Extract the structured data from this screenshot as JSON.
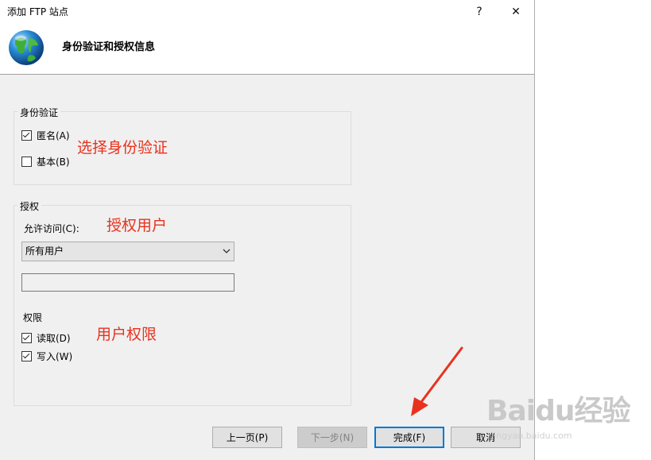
{
  "window": {
    "title": "添加 FTP 站点",
    "help_label": "?",
    "close_label": "✕"
  },
  "header": {
    "title": "身份验证和授权信息",
    "icon": "globe-icon"
  },
  "authentication": {
    "legend": "身份验证",
    "options": [
      {
        "label": "匿名(A)",
        "checked": true
      },
      {
        "label": "基本(B)",
        "checked": false
      }
    ]
  },
  "authorization": {
    "legend": "授权",
    "allow_access_label": "允许访问(C):",
    "allow_access_value": "所有用户",
    "user_textbox_value": "",
    "permissions_label": "权限",
    "permissions": [
      {
        "label": "读取(D)",
        "checked": true
      },
      {
        "label": "写入(W)",
        "checked": true
      }
    ]
  },
  "annotations": {
    "auth": "选择身份验证",
    "authz_users": "授权用户",
    "permissions": "用户权限",
    "color": "#e8321e"
  },
  "buttons": {
    "prev": "上一页(P)",
    "next": "下一步(N)",
    "finish": "完成(F)",
    "cancel": "取消"
  },
  "watermark": {
    "brand": "Baidu经验",
    "url": "jingyan.baidu.com"
  }
}
